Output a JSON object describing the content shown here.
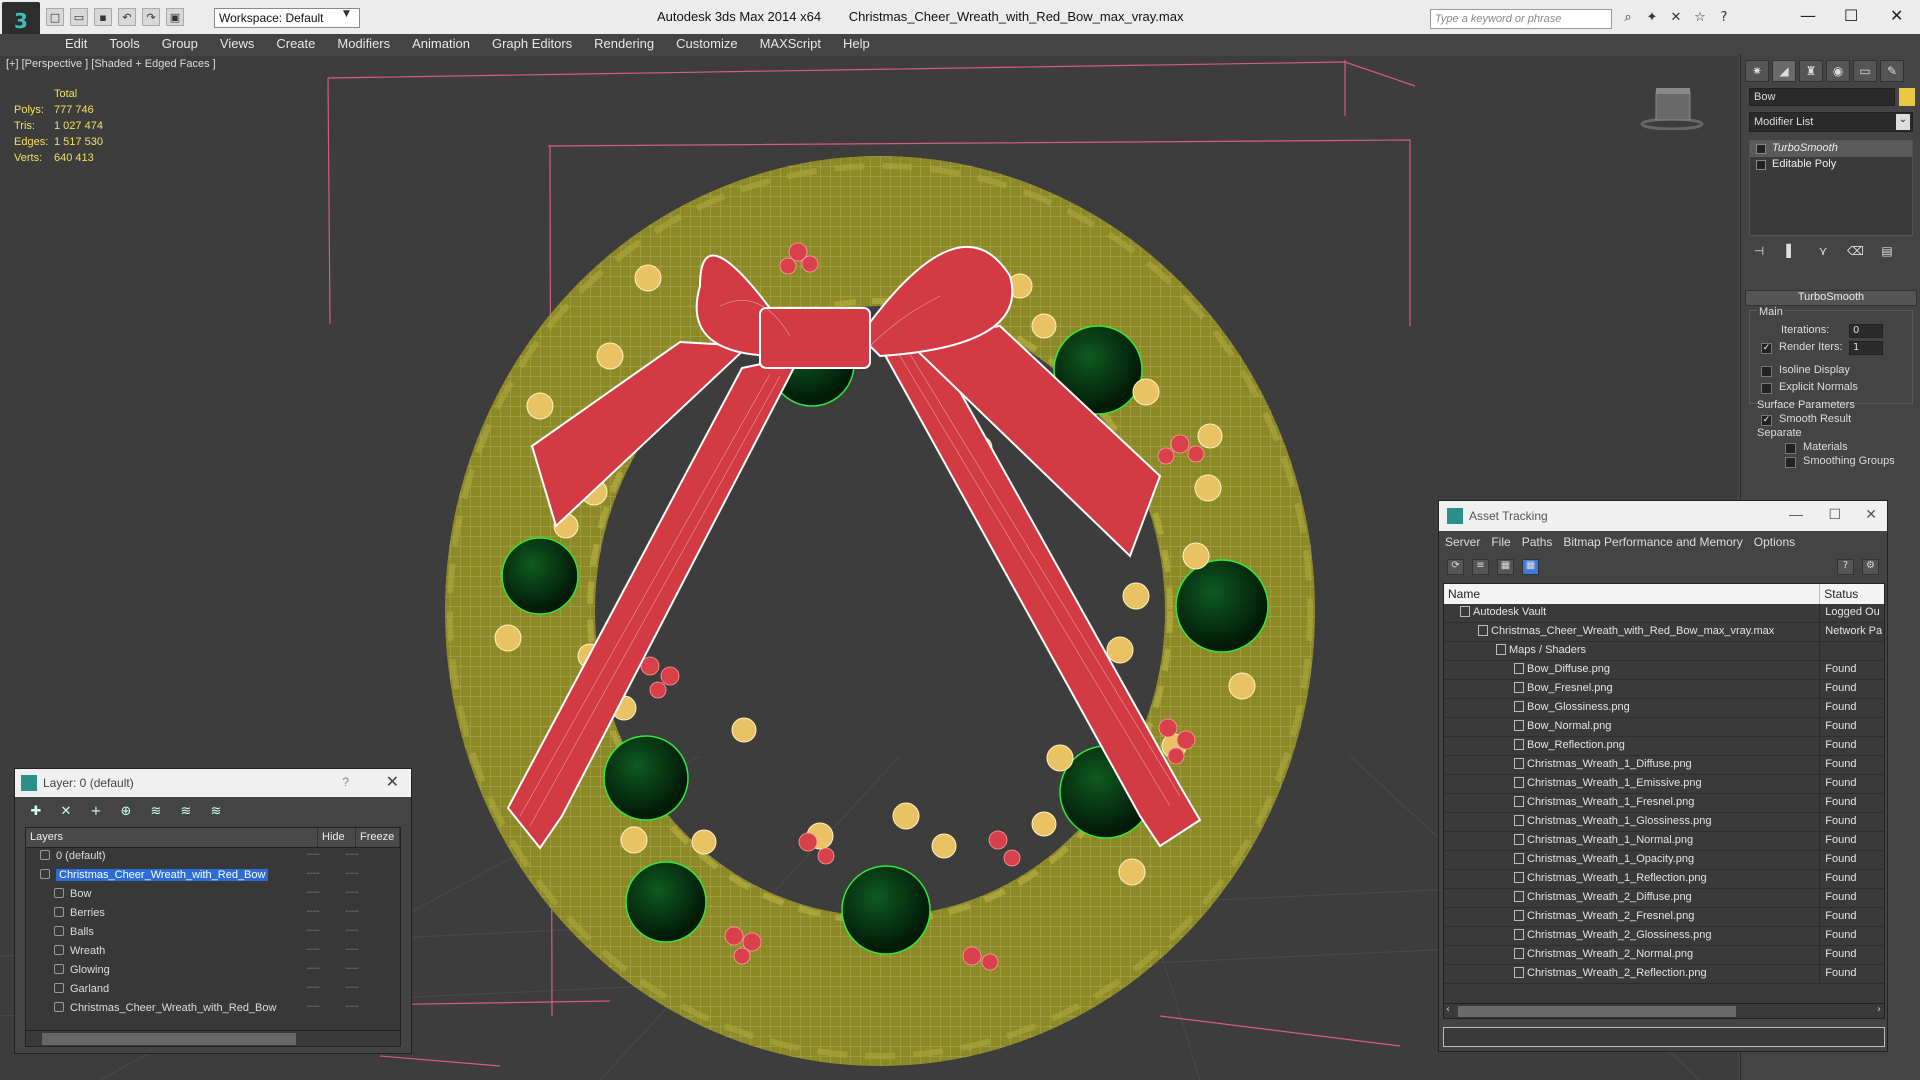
{
  "app": {
    "title": "Autodesk 3ds Max  2014 x64",
    "file": "Christmas_Cheer_Wreath_with_Red_Bow_max_vray.max",
    "workspace": "Workspace: Default",
    "search_placeholder": "Type a keyword or phrase"
  },
  "menu": [
    "Edit",
    "Tools",
    "Group",
    "Views",
    "Create",
    "Modifiers",
    "Animation",
    "Graph Editors",
    "Rendering",
    "Customize",
    "MAXScript",
    "Help"
  ],
  "viewport": {
    "label": "[+] [Perspective ] [Shaded + Edged Faces ]",
    "stats": {
      "header": "Total",
      "rows": [
        {
          "k": "Polys:",
          "v": "777 746"
        },
        {
          "k": "Tris:",
          "v": "1 027 474"
        },
        {
          "k": "Edges:",
          "v": "1 517 530"
        },
        {
          "k": "Verts:",
          "v": "640 413"
        }
      ]
    }
  },
  "command_panel": {
    "object_name": "Bow",
    "object_color": "#e8c840",
    "modifier_list": "Modifier List",
    "stack": [
      "TurboSmooth",
      "Editable Poly"
    ],
    "rollout_title": "TurboSmooth",
    "main_label": "Main",
    "iterations_label": "Iterations:",
    "iterations_value": "0",
    "render_iters_label": "Render Iters:",
    "render_iters_value": "1",
    "isoline_label": "Isoline Display",
    "explicit_normals_label": "Explicit Normals",
    "surface_params_label": "Surface Parameters",
    "smooth_result_label": "Smooth Result",
    "separate_label": "Separate",
    "materials_label": "Materials",
    "smoothing_groups_label": "Smoothing Groups"
  },
  "layer_window": {
    "title": "Layer: 0 (default)",
    "help": "?",
    "columns": [
      "Layers",
      "Hide",
      "Freeze"
    ],
    "rows": [
      {
        "name": "0 (default)",
        "indent": 1,
        "selected": false
      },
      {
        "name": "Christmas_Cheer_Wreath_with_Red_Bow",
        "indent": 1,
        "selected": true
      },
      {
        "name": "Bow",
        "indent": 2,
        "selected": false
      },
      {
        "name": "Berries",
        "indent": 2,
        "selected": false
      },
      {
        "name": "Balls",
        "indent": 2,
        "selected": false
      },
      {
        "name": "Wreath",
        "indent": 2,
        "selected": false
      },
      {
        "name": "Glowing",
        "indent": 2,
        "selected": false
      },
      {
        "name": "Garland",
        "indent": 2,
        "selected": false
      },
      {
        "name": "Christmas_Cheer_Wreath_with_Red_Bow",
        "indent": 2,
        "selected": false
      }
    ]
  },
  "asset_tracking": {
    "title": "Asset Tracking",
    "menu": [
      "Server",
      "File",
      "Paths",
      "Bitmap Performance and Memory",
      "Options"
    ],
    "columns": [
      "Name",
      "Status"
    ],
    "rows": [
      {
        "name": "Autodesk Vault",
        "status": "Logged Ou",
        "indent": 1
      },
      {
        "name": "Christmas_Cheer_Wreath_with_Red_Bow_max_vray.max",
        "status": "Network Pa",
        "indent": 2
      },
      {
        "name": "Maps / Shaders",
        "status": "",
        "indent": 3
      },
      {
        "name": "Bow_Diffuse.png",
        "status": "Found",
        "indent": 4
      },
      {
        "name": "Bow_Fresnel.png",
        "status": "Found",
        "indent": 4
      },
      {
        "name": "Bow_Glossiness.png",
        "status": "Found",
        "indent": 4
      },
      {
        "name": "Bow_Normal.png",
        "status": "Found",
        "indent": 4
      },
      {
        "name": "Bow_Reflection.png",
        "status": "Found",
        "indent": 4
      },
      {
        "name": "Christmas_Wreath_1_Diffuse.png",
        "status": "Found",
        "indent": 4
      },
      {
        "name": "Christmas_Wreath_1_Emissive.png",
        "status": "Found",
        "indent": 4
      },
      {
        "name": "Christmas_Wreath_1_Fresnel.png",
        "status": "Found",
        "indent": 4
      },
      {
        "name": "Christmas_Wreath_1_Glossiness.png",
        "status": "Found",
        "indent": 4
      },
      {
        "name": "Christmas_Wreath_1_Normal.png",
        "status": "Found",
        "indent": 4
      },
      {
        "name": "Christmas_Wreath_1_Opacity.png",
        "status": "Found",
        "indent": 4
      },
      {
        "name": "Christmas_Wreath_1_Reflection.png",
        "status": "Found",
        "indent": 4
      },
      {
        "name": "Christmas_Wreath_2_Diffuse.png",
        "status": "Found",
        "indent": 4
      },
      {
        "name": "Christmas_Wreath_2_Fresnel.png",
        "status": "Found",
        "indent": 4
      },
      {
        "name": "Christmas_Wreath_2_Glossiness.png",
        "status": "Found",
        "indent": 4
      },
      {
        "name": "Christmas_Wreath_2_Normal.png",
        "status": "Found",
        "indent": 4
      },
      {
        "name": "Christmas_Wreath_2_Reflection.png",
        "status": "Found",
        "indent": 4
      }
    ]
  }
}
